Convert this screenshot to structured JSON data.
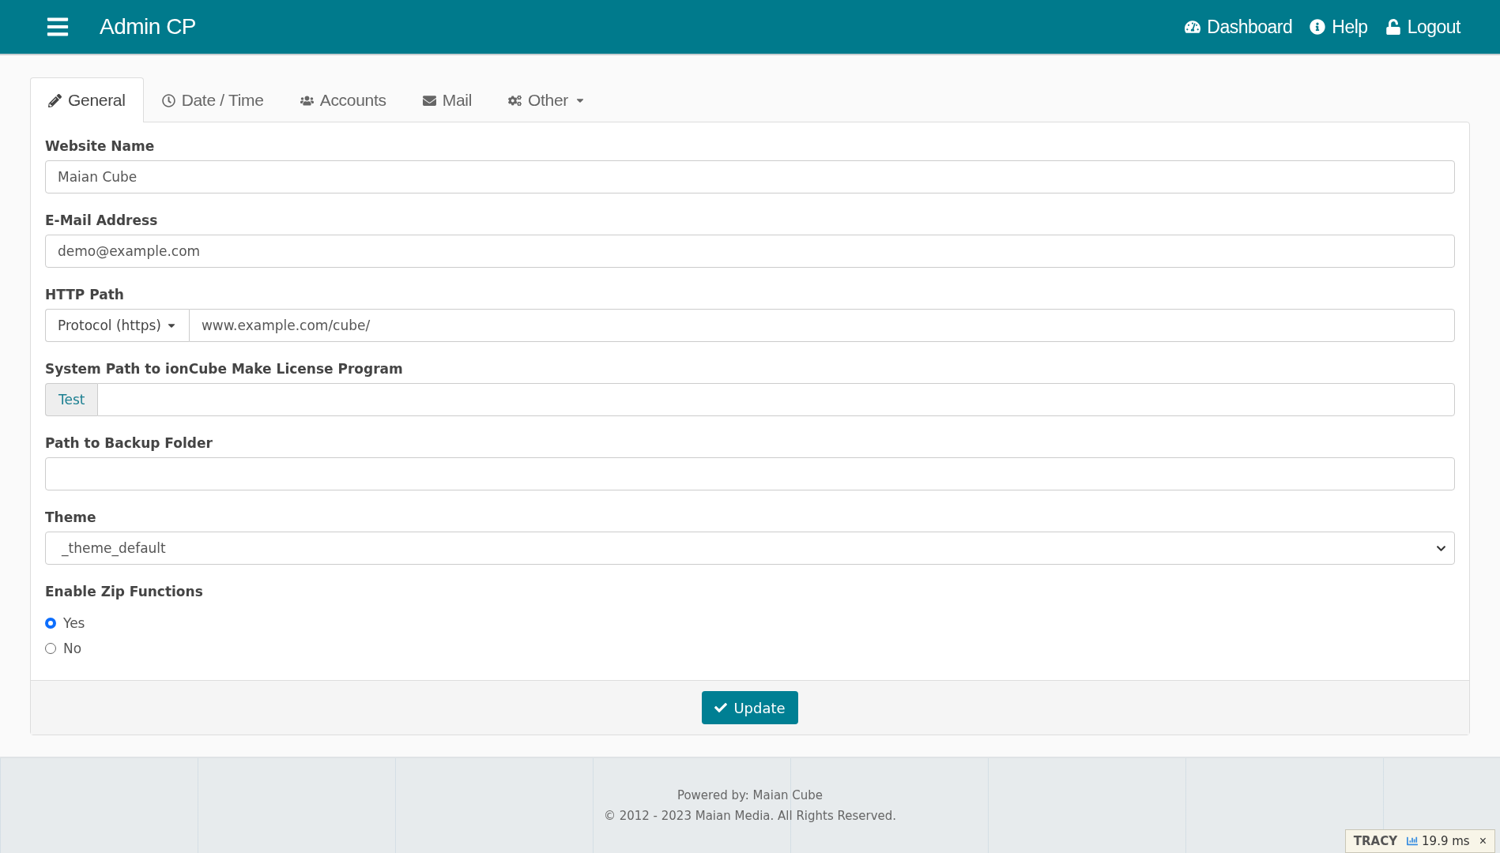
{
  "header": {
    "title": "Admin CP",
    "links": [
      {
        "label": "Dashboard"
      },
      {
        "label": "Help"
      },
      {
        "label": "Logout"
      }
    ]
  },
  "tabs": [
    {
      "label": "General",
      "selected": true,
      "dropdown": false
    },
    {
      "label": "Date / Time",
      "selected": false,
      "dropdown": false
    },
    {
      "label": "Accounts",
      "selected": false,
      "dropdown": false
    },
    {
      "label": "Mail",
      "selected": false,
      "dropdown": false
    },
    {
      "label": "Other",
      "selected": false,
      "dropdown": true
    }
  ],
  "fields": [
    {
      "kind": "text",
      "label": "Website Name",
      "value": "Maian Cube"
    },
    {
      "kind": "text",
      "label": "E-Mail Address",
      "value": "demo@example.com"
    },
    {
      "kind": "addon-dropdown",
      "label": "HTTP Path",
      "addon": "Protocol (https)",
      "value": "www.example.com/cube/"
    },
    {
      "kind": "addon-button",
      "label": "System Path to ionCube Make License Program",
      "addon": "Test"
    },
    {
      "kind": "text",
      "label": "Path to Backup Folder"
    },
    {
      "kind": "select",
      "label": "Theme",
      "value": "_theme_default"
    },
    {
      "kind": "radio",
      "label": "Enable Zip Functions",
      "options": [
        {
          "label": "Yes",
          "selected": true
        },
        {
          "label": "No",
          "selected": false
        }
      ]
    }
  ],
  "submit": "Update",
  "footer": {
    "powered": "Powered by: Maian Cube",
    "copyright": "© 2012 - 2023 Maian Media. All Rights Reserved."
  },
  "debug_bar": {
    "label": "TRACY",
    "time": "19.9 ms",
    "close": "×"
  }
}
